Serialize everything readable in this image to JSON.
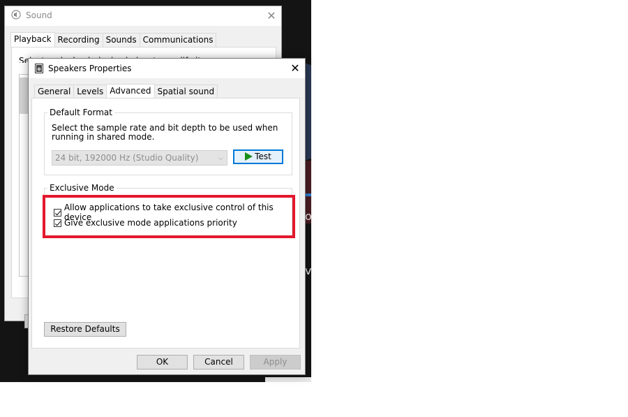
{
  "desktop": {
    "text_fragment_1": "o",
    "text_fragment_2": "v"
  },
  "sound_window": {
    "title": "Sound",
    "close_glyph": "✕",
    "tabs": [
      {
        "label": "Playback",
        "active": true
      },
      {
        "label": "Recording",
        "active": false
      },
      {
        "label": "Sounds",
        "active": false
      },
      {
        "label": "Communications",
        "active": false
      }
    ],
    "instruction": "Select a playback device below to modify its settings:"
  },
  "speakers_window": {
    "title": "Speakers Properties",
    "close_glyph": "✕",
    "tabs": [
      {
        "label": "General",
        "active": false
      },
      {
        "label": "Levels",
        "active": false
      },
      {
        "label": "Advanced",
        "active": true
      },
      {
        "label": "Spatial sound",
        "active": false
      }
    ],
    "default_format": {
      "label": "Default Format",
      "description": "Select the sample rate and bit depth to be used when running in shared mode.",
      "selected_format": "24 bit, 192000 Hz (Studio Quality)",
      "dropdown_glyph": "⌵",
      "test_label": "Test"
    },
    "exclusive_mode": {
      "label": "Exclusive Mode",
      "allow_exclusive_label": "Allow applications to take exclusive control of this device",
      "allow_exclusive_checked": true,
      "priority_label": "Give exclusive mode applications priority",
      "priority_checked": true
    },
    "restore_defaults_label": "Restore Defaults",
    "buttons": {
      "ok": "OK",
      "cancel": "Cancel",
      "apply": "Apply"
    }
  },
  "colors": {
    "highlight": "#e3182e",
    "focus_blue": "#0078d7",
    "play_green": "#1a8e1a"
  }
}
